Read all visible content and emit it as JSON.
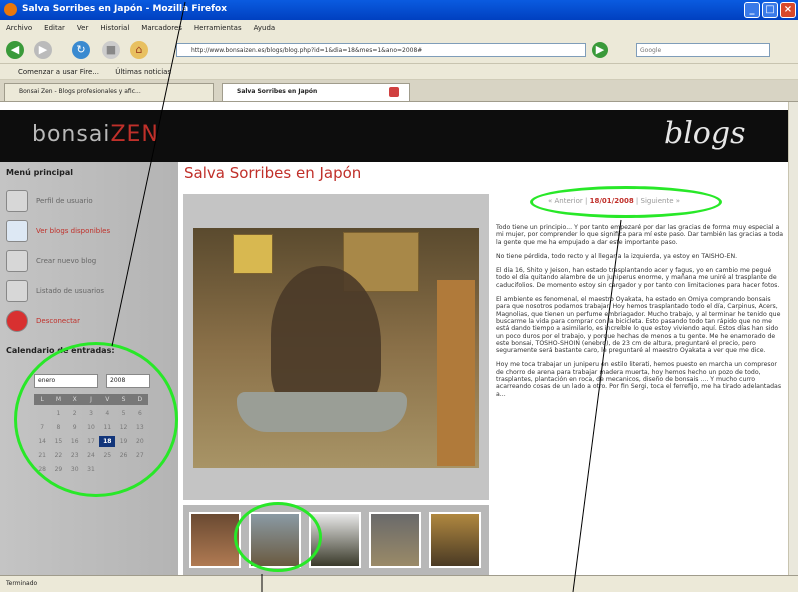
{
  "window": {
    "title": "Salva Sorribes en Japón - Mozilla Firefox"
  },
  "menu": [
    "Archivo",
    "Editar",
    "Ver",
    "Historial",
    "Marcadores",
    "Herramientas",
    "Ayuda"
  ],
  "toolbar": {
    "url": "http://www.bonsaizen.es/blogs/blog.php?id=1&dia=18&mes=1&ano=2008#",
    "search_placeholder": "Google"
  },
  "bookmarks": [
    "Comenzar a usar Fire...",
    "Últimas noticias"
  ],
  "tabs": [
    "Bonsai Zen - Blogs profesionales y afic...",
    "Salva Sorribes en Japón"
  ],
  "site": {
    "brand_main": "bonsai",
    "brand_accent": "ZEN",
    "brand_right": "blogs"
  },
  "sidebar": {
    "menu_title": "Menú principal",
    "items": [
      {
        "label": "Perfil de usuario",
        "icon": "tools-icon"
      },
      {
        "label": "Ver blogs disponibles",
        "icon": "blog-icon"
      },
      {
        "label": "Crear nuevo blog",
        "icon": "printer-icon"
      },
      {
        "label": "Listado de usuarios",
        "icon": "users-icon"
      },
      {
        "label": "Desconectar",
        "icon": "power-icon"
      }
    ],
    "calendar_title": "Calendario de entradas:",
    "month": "enero",
    "year": "2008",
    "weekdays": [
      "L",
      "M",
      "X",
      "J",
      "V",
      "S",
      "D"
    ],
    "days": [
      "",
      "1",
      "2",
      "3",
      "4",
      "5",
      "6",
      "7",
      "8",
      "9",
      "10",
      "11",
      "12",
      "13",
      "14",
      "15",
      "16",
      "17",
      "18",
      "19",
      "20",
      "21",
      "22",
      "23",
      "24",
      "25",
      "26",
      "27",
      "28",
      "29",
      "30",
      "31",
      "",
      "",
      ""
    ],
    "today": "18"
  },
  "post": {
    "title": "Salva Sorribes en Japón",
    "nav_prev": "« Anterior",
    "nav_date": "18/01/2008",
    "nav_next": "Siguiente »",
    "sep": "|",
    "paragraphs": [
      "Todo tiene un principio... Y por tanto empezaré por dar las gracias de forma muy especial a mi mujer, por comprender lo que significa para mí este paso. Dar también las gracias a toda la gente que me ha empujado a dar este importante paso.",
      "No tiene pérdida, todo recto y al llegar a la izquierda, ya estoy en TAISHO-EN.",
      "El día 16, Shito y Jeison, han estado trasplantando acer y fagus, yo en cambio me pegué todo el día quitando alambre de un juniperus enorme, y mañana me uniré al trasplante de caducifolios. De momento estoy sin cargador y por tanto con limitaciones para hacer fotos.",
      "El ambiente es fenomenal, el maestro Oyakata, ha estado en Omiya comprando bonsais para que nosotros podamos trabajar. Hoy hemos trasplantado todo el día, Carpinus, Acers, Magnolias, que tienen un perfume embriagador. Mucho trabajo, y al terminar he tenido que buscarme la vida para comprar con la bicicleta. Esto pasando todo tan rápido que no me está dando tiempo a asimilarlo, es increíble lo que estoy viviendo aquí. Estos días han sido un poco duros por el trabajo, y porque hechas de menos a tu gente. Me he enamorado de este bonsai, TOSHO-SHOIN (enebro), de 23 cm de altura, preguntaré el precio, pero seguramente será bastante caro, le preguntaré al maestro Oyakata a ver que me dice.",
      "Hoy me toca trabajar un juniperu en estilo literati, hemos puesto en marcha un compresor de chorro de arena para trabajar madera muerta, hoy hemos hecho un pozo de todo, trasplantes, plantación en roca, de mecanicos, diseño de bonsais .... Y mucho curro acarreando cosas de un lado a otro. Por fin Sergi, toca el ferrefijo, me ha tirado adelantadas a..."
    ]
  },
  "status": "Terminado"
}
